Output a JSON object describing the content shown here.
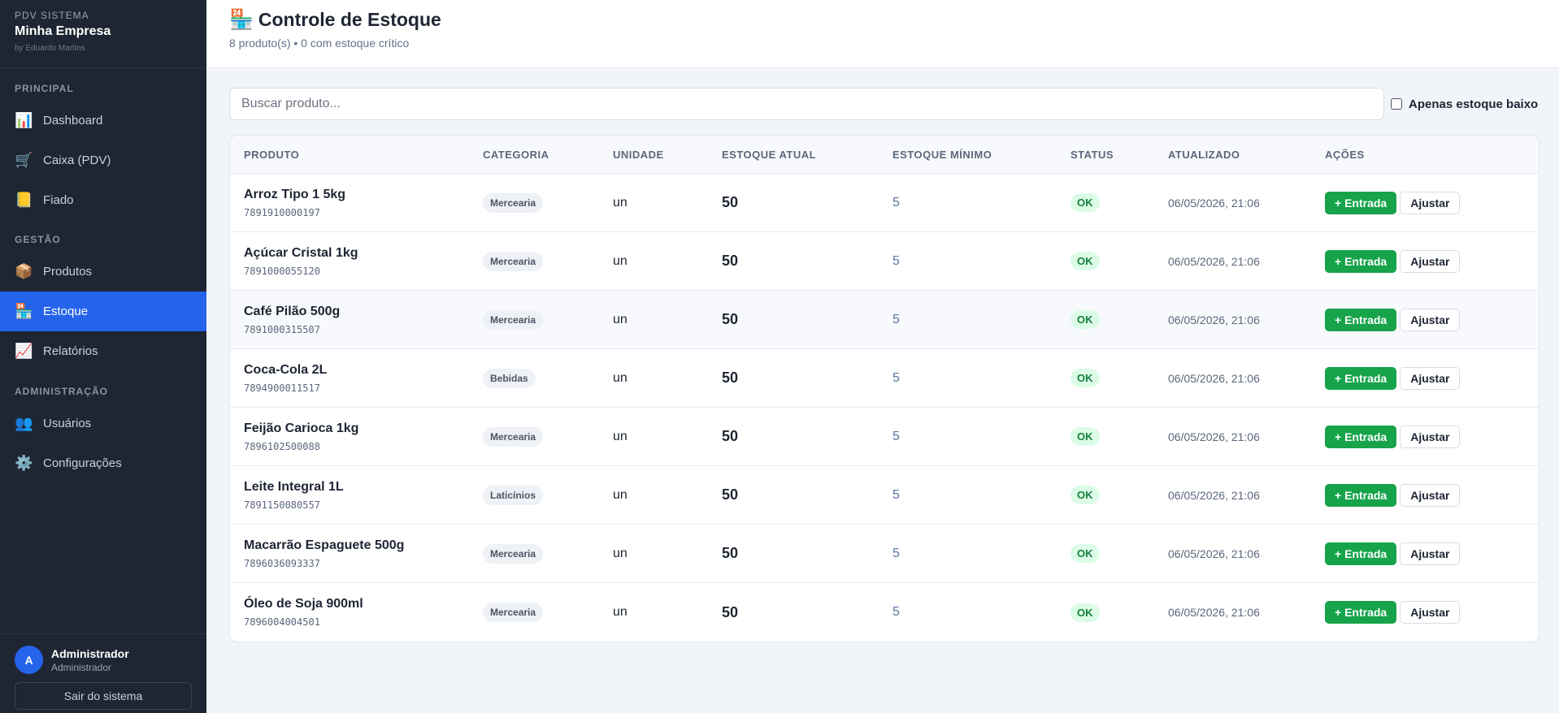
{
  "sidebar": {
    "brand_system": "PDV SISTEMA",
    "brand_name": "Minha Empresa",
    "brand_by": "by Eduardo Martins",
    "sections": [
      {
        "title": "PRINCIPAL",
        "items": [
          {
            "icon": "bar-chart-icon",
            "glyph": "📊",
            "label": "Dashboard"
          },
          {
            "icon": "cart-icon",
            "glyph": "🛒",
            "label": "Caixa (PDV)"
          },
          {
            "icon": "ledger-icon",
            "glyph": "📒",
            "label": "Fiado"
          }
        ]
      },
      {
        "title": "GESTÃO",
        "items": [
          {
            "icon": "package-icon",
            "glyph": "📦",
            "label": "Produtos"
          },
          {
            "icon": "store-icon",
            "glyph": "🏪",
            "label": "Estoque",
            "active": true
          },
          {
            "icon": "trend-chart-icon",
            "glyph": "📈",
            "label": "Relatórios"
          }
        ]
      },
      {
        "title": "ADMINISTRAÇÃO",
        "items": [
          {
            "icon": "users-icon",
            "glyph": "👥",
            "label": "Usuários"
          },
          {
            "icon": "gear-icon",
            "glyph": "⚙️",
            "label": "Configurações"
          }
        ]
      }
    ],
    "user": {
      "initial": "A",
      "name": "Administrador",
      "role": "Administrador"
    },
    "logout_label": "Sair do sistema"
  },
  "header": {
    "icon": "store-icon",
    "glyph": "🏪",
    "title": "Controle de Estoque",
    "subtitle": "8 produto(s) • 0 com estoque crítico"
  },
  "toolbar": {
    "search_placeholder": "Buscar produto...",
    "low_stock_label": "Apenas estoque baixo"
  },
  "table": {
    "columns": [
      "PRODUTO",
      "CATEGORIA",
      "UNIDADE",
      "ESTOQUE ATUAL",
      "ESTOQUE MÍNIMO",
      "STATUS",
      "ATUALIZADO",
      "AÇÕES"
    ],
    "entrada_label": "+ Entrada",
    "ajustar_label": "Ajustar",
    "rows": [
      {
        "name": "Arroz Tipo 1 5kg",
        "code": "7891910000197",
        "category": "Mercearia",
        "unit": "un",
        "stock": "50",
        "min": "5",
        "status": "OK",
        "updated": "06/05/2026, 21:06"
      },
      {
        "name": "Açúcar Cristal 1kg",
        "code": "7891000055120",
        "category": "Mercearia",
        "unit": "un",
        "stock": "50",
        "min": "5",
        "status": "OK",
        "updated": "06/05/2026, 21:06"
      },
      {
        "name": "Café Pilão 500g",
        "code": "7891000315507",
        "category": "Mercearia",
        "unit": "un",
        "stock": "50",
        "min": "5",
        "status": "OK",
        "updated": "06/05/2026, 21:06"
      },
      {
        "name": "Coca-Cola 2L",
        "code": "7894900011517",
        "category": "Bebidas",
        "unit": "un",
        "stock": "50",
        "min": "5",
        "status": "OK",
        "updated": "06/05/2026, 21:06"
      },
      {
        "name": "Feijão Carioca 1kg",
        "code": "7896102500088",
        "category": "Mercearia",
        "unit": "un",
        "stock": "50",
        "min": "5",
        "status": "OK",
        "updated": "06/05/2026, 21:06"
      },
      {
        "name": "Leite Integral 1L",
        "code": "7891150080557",
        "category": "Laticínios",
        "unit": "un",
        "stock": "50",
        "min": "5",
        "status": "OK",
        "updated": "06/05/2026, 21:06"
      },
      {
        "name": "Macarrão Espaguete 500g",
        "code": "7896036093337",
        "category": "Mercearia",
        "unit": "un",
        "stock": "50",
        "min": "5",
        "status": "OK",
        "updated": "06/05/2026, 21:06"
      },
      {
        "name": "Óleo de Soja 900ml",
        "code": "7896004004501",
        "category": "Mercearia",
        "unit": "un",
        "stock": "50",
        "min": "5",
        "status": "OK",
        "updated": "06/05/2026, 21:06"
      }
    ]
  }
}
